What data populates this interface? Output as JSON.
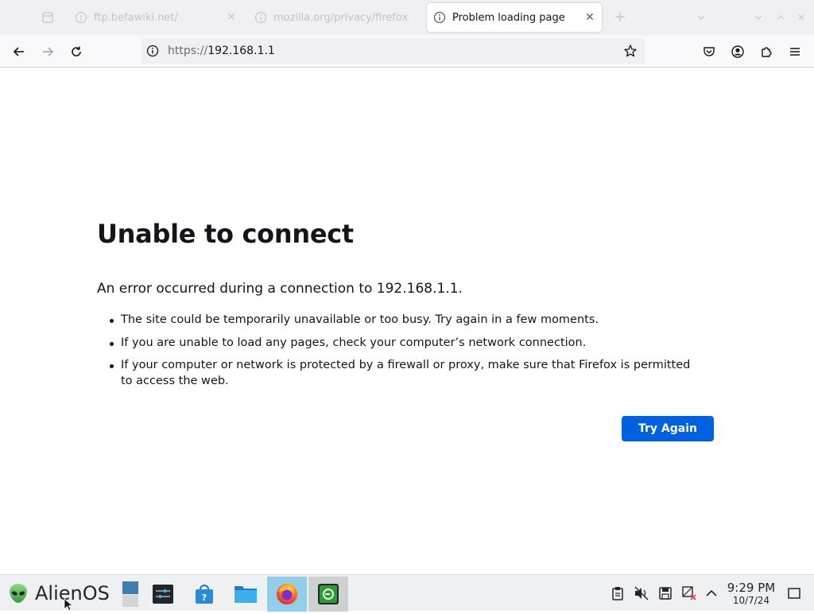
{
  "browser": {
    "tabs": [
      {
        "label": "ftp.befawiki.net/",
        "active": false
      },
      {
        "label": "mozilla.org/privacy/firefox/",
        "active": false
      },
      {
        "label": "Problem loading page",
        "active": true
      }
    ],
    "url": {
      "scheme": "https://",
      "host": "192.168.1.1"
    }
  },
  "error_page": {
    "title": "Unable to connect",
    "description": "An error occurred during a connection to 192.168.1.1.",
    "bullets": [
      "The site could be temporarily unavailable or too busy. Try again in a few moments.",
      "If you are unable to load any pages, check your computer’s network connection.",
      "If your computer or network is protected by a firewall or proxy, make sure that Firefox is permitted to access the web."
    ],
    "try_again_label": "Try Again"
  },
  "taskbar": {
    "start_label": "AlienOS",
    "apps": [
      {
        "icon": "desktop-switcher-icon"
      },
      {
        "icon": "system-settings-icon"
      },
      {
        "icon": "software-store-icon"
      },
      {
        "icon": "file-manager-icon"
      },
      {
        "icon": "firefox-icon",
        "state": "active"
      },
      {
        "icon": "terminal-icon",
        "state": "open"
      }
    ],
    "tray": [
      "clipboard-icon",
      "volume-muted-icon",
      "storage-icon",
      "network-disconnected-icon",
      "expand-tray-icon"
    ],
    "clock": {
      "time": "9:29 PM",
      "date": "10/7/24"
    }
  },
  "colors": {
    "accent": "#0061e0",
    "tabstrip": "#f0f0f4",
    "taskbar_active": "#93cee9"
  }
}
